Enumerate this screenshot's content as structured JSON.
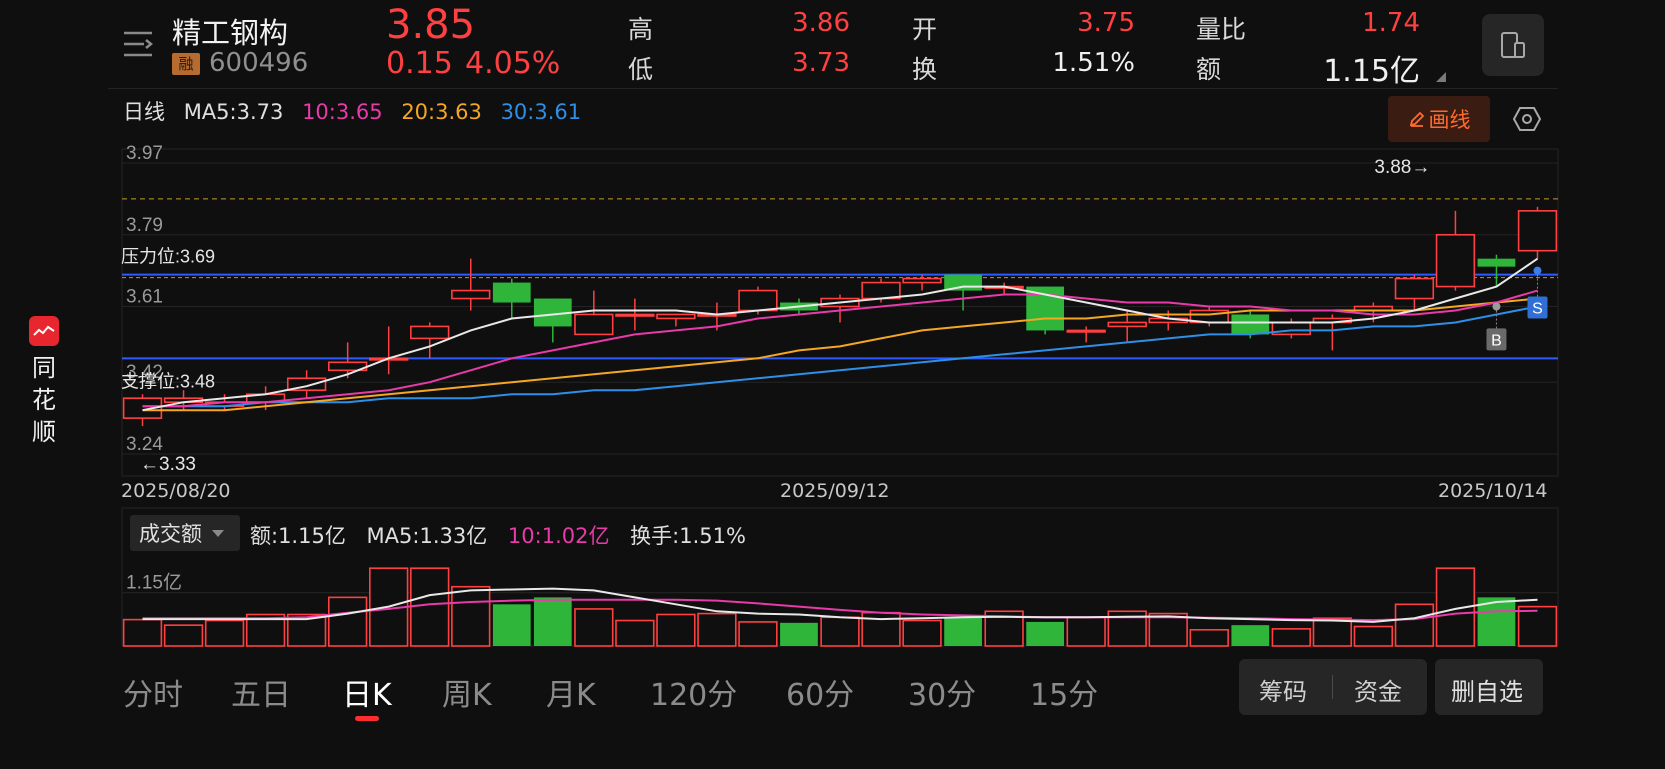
{
  "brand": {
    "chars": [
      "同",
      "花",
      "顺"
    ]
  },
  "stock": {
    "name": "精工钢构",
    "margin_tag": "融",
    "code": "600496",
    "price": "3.85",
    "change": "0.15",
    "change_pct": "4.05%"
  },
  "quote": {
    "high_label": "高",
    "high": "3.86",
    "low_label": "低",
    "low": "3.73",
    "open_label": "开",
    "open": "3.75",
    "turnover_label": "换",
    "turnover": "1.51%",
    "vol_ratio_label": "量比",
    "vol_ratio": "1.74",
    "amount_label": "额",
    "amount": "1.15亿"
  },
  "ma_bar": {
    "period": "日线",
    "ma5": "MA5:3.73",
    "ma10": "10:3.65",
    "ma20": "20:3.63",
    "ma30": "30:3.61",
    "draw_button": "画线"
  },
  "colors": {
    "up": "#ff4040",
    "down": "#2fb53a",
    "ma5": "#e8e8e8",
    "ma10": "#e83aa8",
    "ma20": "#f5a623",
    "ma30": "#2e8fe6",
    "level_line": "#2d5bff"
  },
  "price_chart": {
    "y_ticks": [
      "3.97",
      "3.79",
      "3.61",
      "3.42",
      "3.24"
    ],
    "resistance_label": "压力位:3.69",
    "support_label": "支撑位:3.48",
    "max_annotation": "3.88→",
    "min_annotation": "←3.33",
    "dates": [
      "2025/08/20",
      "2025/09/12",
      "2025/10/14"
    ],
    "buy_marker": "B",
    "sell_marker": "S"
  },
  "chart_data": {
    "type": "candlestick",
    "y_range": [
      3.24,
      3.97
    ],
    "resistance": 3.69,
    "support": 3.48,
    "reference_high": 3.88,
    "candles": [
      {
        "o": 3.33,
        "c": 3.38,
        "h": 3.39,
        "l": 3.31
      },
      {
        "o": 3.37,
        "c": 3.38,
        "h": 3.4,
        "l": 3.35
      },
      {
        "o": 3.36,
        "c": 3.37,
        "h": 3.39,
        "l": 3.35
      },
      {
        "o": 3.37,
        "c": 3.39,
        "h": 3.41,
        "l": 3.35
      },
      {
        "o": 3.4,
        "c": 3.43,
        "h": 3.45,
        "l": 3.38
      },
      {
        "o": 3.45,
        "c": 3.47,
        "h": 3.52,
        "l": 3.43
      },
      {
        "o": 3.48,
        "c": 3.48,
        "h": 3.56,
        "l": 3.44
      },
      {
        "o": 3.53,
        "c": 3.56,
        "h": 3.57,
        "l": 3.48
      },
      {
        "o": 3.63,
        "c": 3.65,
        "h": 3.73,
        "l": 3.6
      },
      {
        "o": 3.67,
        "c": 3.62,
        "h": 3.68,
        "l": 3.58
      },
      {
        "o": 3.63,
        "c": 3.56,
        "h": 3.63,
        "l": 3.52
      },
      {
        "o": 3.54,
        "c": 3.59,
        "h": 3.65,
        "l": 3.54
      },
      {
        "o": 3.59,
        "c": 3.59,
        "h": 3.63,
        "l": 3.55
      },
      {
        "o": 3.58,
        "c": 3.59,
        "h": 3.59,
        "l": 3.56
      },
      {
        "o": 3.59,
        "c": 3.59,
        "h": 3.62,
        "l": 3.55
      },
      {
        "o": 3.6,
        "c": 3.65,
        "h": 3.66,
        "l": 3.59
      },
      {
        "o": 3.62,
        "c": 3.6,
        "h": 3.63,
        "l": 3.59
      },
      {
        "o": 3.61,
        "c": 3.63,
        "h": 3.64,
        "l": 3.57
      },
      {
        "o": 3.63,
        "c": 3.67,
        "h": 3.68,
        "l": 3.62
      },
      {
        "o": 3.67,
        "c": 3.68,
        "h": 3.69,
        "l": 3.65
      },
      {
        "o": 3.69,
        "c": 3.65,
        "h": 3.69,
        "l": 3.6
      },
      {
        "o": 3.66,
        "c": 3.66,
        "h": 3.67,
        "l": 3.64
      },
      {
        "o": 3.66,
        "c": 3.55,
        "h": 3.66,
        "l": 3.54
      },
      {
        "o": 3.55,
        "c": 3.55,
        "h": 3.56,
        "l": 3.52
      },
      {
        "o": 3.56,
        "c": 3.57,
        "h": 3.6,
        "l": 3.52
      },
      {
        "o": 3.57,
        "c": 3.58,
        "h": 3.6,
        "l": 3.55
      },
      {
        "o": 3.57,
        "c": 3.6,
        "h": 3.61,
        "l": 3.56
      },
      {
        "o": 3.59,
        "c": 3.54,
        "h": 3.6,
        "l": 3.53
      },
      {
        "o": 3.54,
        "c": 3.57,
        "h": 3.58,
        "l": 3.53
      },
      {
        "o": 3.57,
        "c": 3.58,
        "h": 3.59,
        "l": 3.5
      },
      {
        "o": 3.6,
        "c": 3.61,
        "h": 3.62,
        "l": 3.57
      },
      {
        "o": 3.63,
        "c": 3.68,
        "h": 3.69,
        "l": 3.6
      },
      {
        "o": 3.66,
        "c": 3.79,
        "h": 3.85,
        "l": 3.65
      },
      {
        "o": 3.73,
        "c": 3.71,
        "h": 3.74,
        "l": 3.66
      },
      {
        "o": 3.75,
        "c": 3.85,
        "h": 3.86,
        "l": 3.73
      }
    ],
    "ma5": [
      3.35,
      3.37,
      3.38,
      3.39,
      3.41,
      3.44,
      3.48,
      3.51,
      3.55,
      3.58,
      3.59,
      3.6,
      3.6,
      3.6,
      3.59,
      3.6,
      3.61,
      3.62,
      3.63,
      3.64,
      3.66,
      3.66,
      3.64,
      3.62,
      3.6,
      3.58,
      3.57,
      3.57,
      3.57,
      3.57,
      3.58,
      3.6,
      3.63,
      3.66,
      3.73
    ],
    "ma10": [
      3.36,
      3.36,
      3.37,
      3.37,
      3.38,
      3.39,
      3.4,
      3.42,
      3.45,
      3.48,
      3.5,
      3.52,
      3.54,
      3.55,
      3.56,
      3.58,
      3.59,
      3.6,
      3.61,
      3.62,
      3.63,
      3.64,
      3.64,
      3.63,
      3.62,
      3.62,
      3.61,
      3.61,
      3.6,
      3.6,
      3.59,
      3.59,
      3.6,
      3.62,
      3.65
    ],
    "ma20": [
      3.35,
      3.35,
      3.35,
      3.36,
      3.37,
      3.38,
      3.39,
      3.4,
      3.41,
      3.42,
      3.43,
      3.44,
      3.45,
      3.46,
      3.47,
      3.48,
      3.5,
      3.51,
      3.53,
      3.55,
      3.56,
      3.57,
      3.58,
      3.58,
      3.59,
      3.59,
      3.59,
      3.6,
      3.6,
      3.6,
      3.6,
      3.6,
      3.61,
      3.62,
      3.63
    ],
    "ma30": [
      3.36,
      3.36,
      3.36,
      3.37,
      3.37,
      3.37,
      3.38,
      3.38,
      3.38,
      3.39,
      3.39,
      3.4,
      3.4,
      3.41,
      3.42,
      3.43,
      3.44,
      3.45,
      3.46,
      3.47,
      3.48,
      3.49,
      3.5,
      3.51,
      3.52,
      3.53,
      3.54,
      3.54,
      3.55,
      3.55,
      3.56,
      3.56,
      3.57,
      3.59,
      3.61
    ],
    "volume_unit": "亿",
    "volume": [
      0.57,
      0.45,
      0.55,
      0.68,
      0.68,
      1.05,
      1.68,
      1.68,
      1.28,
      0.9,
      1.05,
      0.8,
      0.55,
      0.68,
      0.7,
      0.52,
      0.5,
      0.62,
      0.72,
      0.55,
      0.62,
      0.75,
      0.52,
      0.62,
      0.75,
      0.7,
      0.35,
      0.45,
      0.37,
      0.6,
      0.42,
      0.9,
      1.68,
      1.05,
      0.85
    ],
    "vol_ma5": [
      0.58,
      0.58,
      0.58,
      0.58,
      0.58,
      0.7,
      0.85,
      1.1,
      1.2,
      1.22,
      1.24,
      1.2,
      1.05,
      0.9,
      0.75,
      0.7,
      0.68,
      0.62,
      0.58,
      0.6,
      0.62,
      0.63,
      0.62,
      0.62,
      0.63,
      0.64,
      0.6,
      0.58,
      0.56,
      0.55,
      0.52,
      0.6,
      0.8,
      0.95,
      1.0
    ],
    "vol_ma10": [
      0.6,
      0.6,
      0.6,
      0.6,
      0.62,
      0.72,
      0.8,
      0.9,
      0.95,
      0.98,
      1.0,
      1.0,
      1.0,
      1.0,
      0.98,
      0.92,
      0.85,
      0.78,
      0.72,
      0.68,
      0.66,
      0.64,
      0.62,
      0.62,
      0.62,
      0.62,
      0.61,
      0.6,
      0.58,
      0.57,
      0.56,
      0.58,
      0.7,
      0.75,
      0.76
    ]
  },
  "volume_panel": {
    "selector": "成交额",
    "amount": "额:1.15亿",
    "ma5": "MA5:1.33亿",
    "ma10": "10:1.02亿",
    "turnover": "换手:1.51%",
    "y_tick": "1.15亿"
  },
  "tabs": [
    "分时",
    "五日",
    "日K",
    "周K",
    "月K",
    "120分",
    "60分",
    "30分",
    "15分"
  ],
  "active_tab": "日K",
  "bottom_buttons": {
    "chips": "筹码",
    "funds": "资金",
    "delete_watch": "删自选"
  }
}
